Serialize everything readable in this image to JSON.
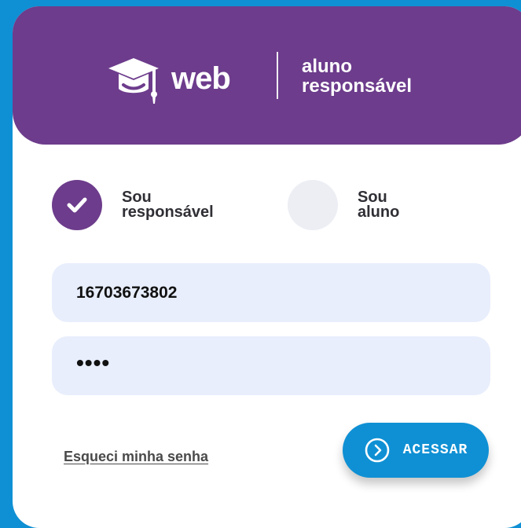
{
  "brand": {
    "logo_icon": "graduation-cap-icon",
    "name": "web",
    "portal_lines": [
      "aluno",
      "responsável"
    ]
  },
  "roles": [
    {
      "lines": [
        "Sou",
        "responsável"
      ],
      "selected": true,
      "icon": "check-icon"
    },
    {
      "lines": [
        "Sou",
        "aluno"
      ],
      "selected": false,
      "icon": ""
    }
  ],
  "login": {
    "username_value": "16703673802",
    "password_value": "••••",
    "forgot_password_label": "Esqueci minha senha",
    "submit_label": "ACESSAR",
    "submit_icon": "arrow-circle-icon"
  },
  "colors": {
    "background": "#0f90d4",
    "header": "#6d3c8c",
    "field_background": "#e8eefc",
    "unselected_role": "#eceef4",
    "button": "#0f90d4"
  }
}
